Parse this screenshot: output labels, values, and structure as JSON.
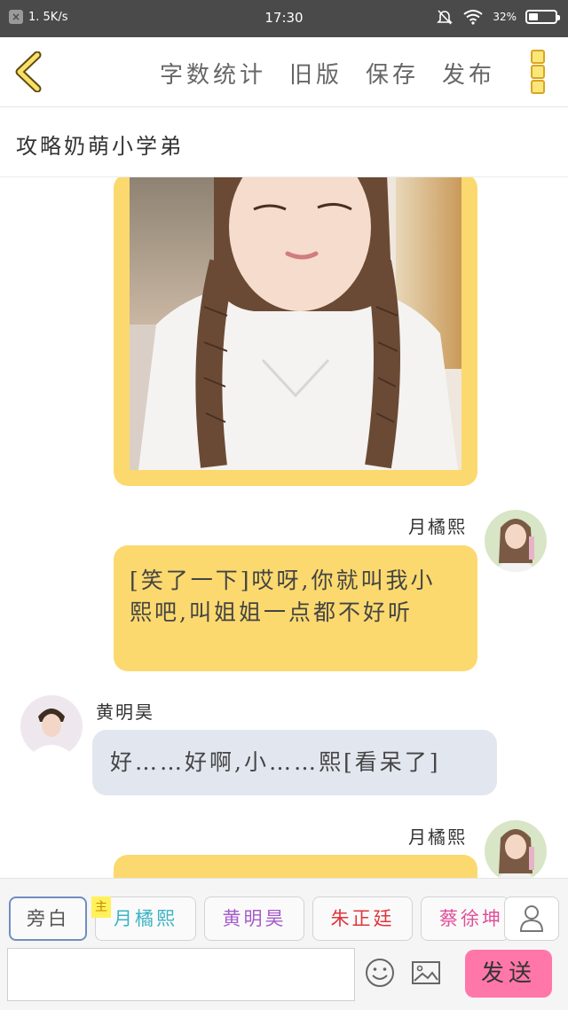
{
  "status": {
    "speed": "1. 5K/s",
    "time": "17:30",
    "battery": "32%"
  },
  "header": {
    "actions": [
      "字数统计",
      "旧版",
      "保存",
      "发布"
    ]
  },
  "story": {
    "title": "攻略奶萌小学弟"
  },
  "messages": [
    {
      "sender": "月橘熙",
      "text": "[笑了一下]哎呀,你就叫我小熙吧,叫姐姐一点都不好听"
    },
    {
      "sender": "黄明昊",
      "text": "好……好啊,小……熙[看呆了]"
    },
    {
      "sender": "月橘熙",
      "text": ""
    }
  ],
  "roles": {
    "items": [
      "旁白",
      "月橘熙",
      "黄明昊",
      "朱正廷",
      "蔡徐坤"
    ],
    "main_tag": "主",
    "colors": [
      "#555555",
      "#3bb3c3",
      "#a55cc9",
      "#e0353b",
      "#e0509a"
    ]
  },
  "composer": {
    "placeholder": "",
    "send_label": "发送"
  },
  "colors": {
    "accent_yellow": "#fbd96e",
    "send_pink": "#ff77a8",
    "reply_gray": "#e2e7ef"
  }
}
